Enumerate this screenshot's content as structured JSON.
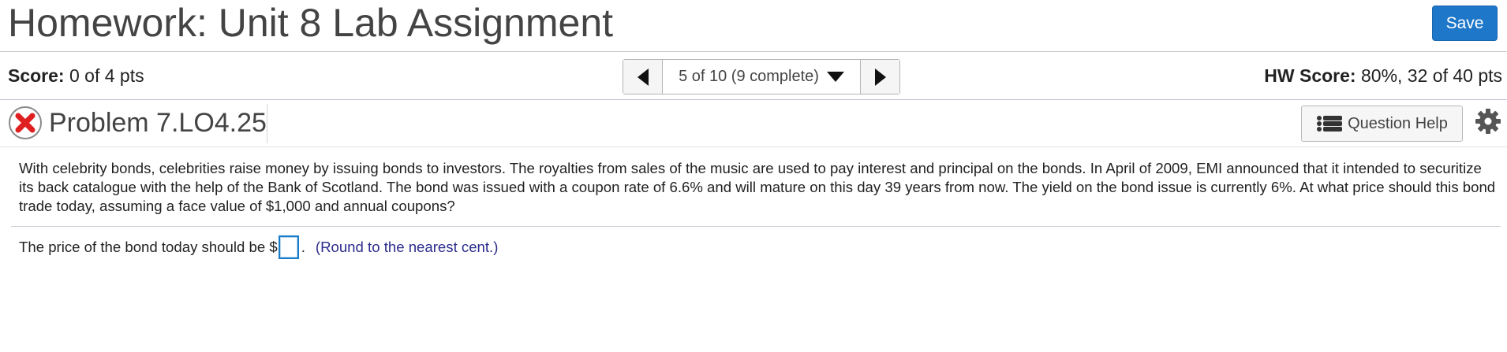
{
  "header": {
    "title": "Homework: Unit 8 Lab Assignment",
    "save_label": "Save"
  },
  "score_bar": {
    "score_label": "Score:",
    "score_value": "0 of 4 pts",
    "nav_position": "5 of 10 (9 complete)",
    "hw_score_label": "HW Score:",
    "hw_score_value": "80%, 32 of 40 pts"
  },
  "problem": {
    "status_icon": "incorrect-x-icon",
    "title": "Problem 7.LO4.25",
    "help_label": "Question Help",
    "help_icon": "list-icon",
    "settings_icon": "gear-icon"
  },
  "question": {
    "text": "With celebrity bonds, celebrities raise money by issuing bonds to investors.  The royalties from sales of the music are used to pay interest and principal on the bonds.  In April of 2009, EMI announced that it intended to securitize its back catalogue with the help of the Bank of Scotland.  The bond was issued with a coupon rate of 6.6% and will mature on this day 39 years from now.  The yield on the bond issue is currently 6%.  At what price should this bond trade today, assuming a face value of $1,000 and annual coupons?",
    "answer_prefix": "The price of the bond today should be $",
    "answer_value": "",
    "answer_suffix": ".",
    "hint": "(Round to the nearest cent.)"
  },
  "colors": {
    "accent": "#1f77c9",
    "error": "#e02020",
    "hint": "#2b2b8c"
  }
}
